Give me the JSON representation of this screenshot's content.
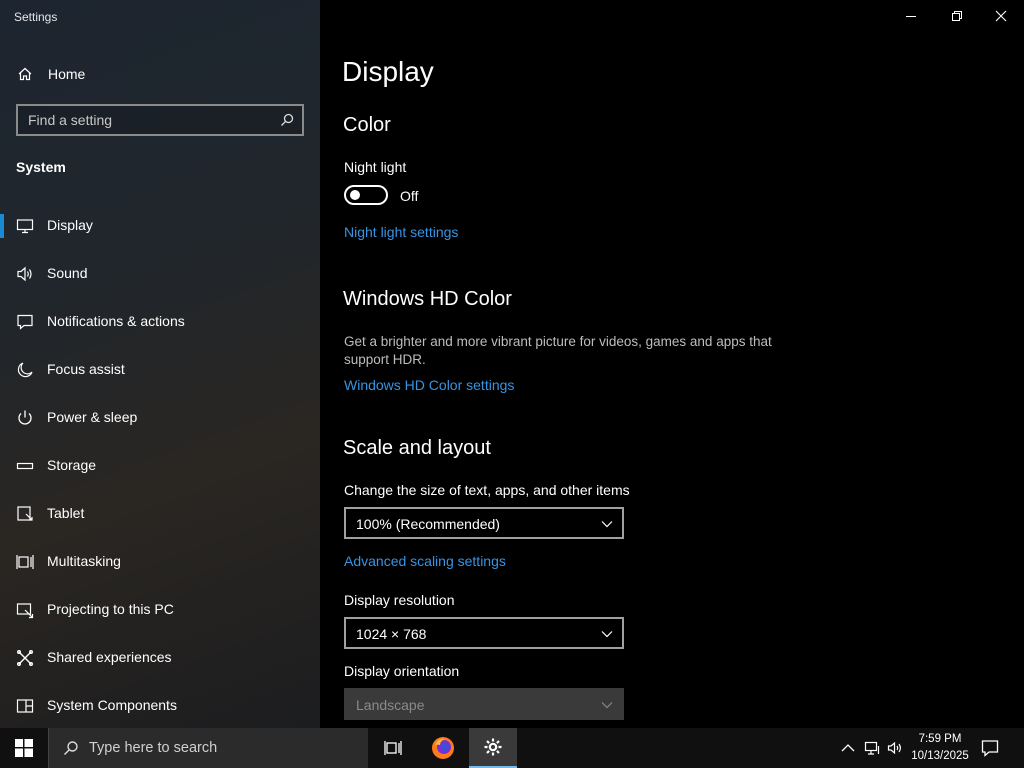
{
  "window": {
    "title": "Settings",
    "minimize_icon": "minimize-icon",
    "maximize_icon": "restore-icon",
    "close_icon": "close-icon"
  },
  "sidebar": {
    "home_label": "Home",
    "search_placeholder": "Find a setting",
    "section": "System",
    "items": [
      {
        "label": "Display",
        "icon": "monitor-icon",
        "active": true
      },
      {
        "label": "Sound",
        "icon": "speaker-icon"
      },
      {
        "label": "Notifications & actions",
        "icon": "message-icon"
      },
      {
        "label": "Focus assist",
        "icon": "moon-icon"
      },
      {
        "label": "Power & sleep",
        "icon": "power-icon"
      },
      {
        "label": "Storage",
        "icon": "storage-icon"
      },
      {
        "label": "Tablet",
        "icon": "tablet-icon"
      },
      {
        "label": "Multitasking",
        "icon": "multitasking-icon"
      },
      {
        "label": "Projecting to this PC",
        "icon": "projecting-icon"
      },
      {
        "label": "Shared experiences",
        "icon": "shared-icon"
      },
      {
        "label": "System Components",
        "icon": "components-icon"
      }
    ]
  },
  "main": {
    "title": "Display",
    "color": {
      "heading": "Color",
      "night_light_label": "Night light",
      "night_light_state": "Off",
      "night_light_link": "Night light settings"
    },
    "hd_color": {
      "heading": "Windows HD Color",
      "description": "Get a brighter and more vibrant picture for videos, games and apps that support HDR.",
      "link": "Windows HD Color settings"
    },
    "scale": {
      "heading": "Scale and layout",
      "size_label": "Change the size of text, apps, and other items",
      "size_value": "100% (Recommended)",
      "advanced_link": "Advanced scaling settings",
      "resolution_label": "Display resolution",
      "resolution_value": "1024 × 768",
      "orientation_label": "Display orientation",
      "orientation_value": "Landscape"
    }
  },
  "taskbar": {
    "search_text": "Type here to search",
    "time": "7:59 PM",
    "date": "10/13/2025"
  },
  "colors": {
    "accent": "#1a8ad4",
    "link": "#3794e4",
    "taskbar": "#101010"
  }
}
